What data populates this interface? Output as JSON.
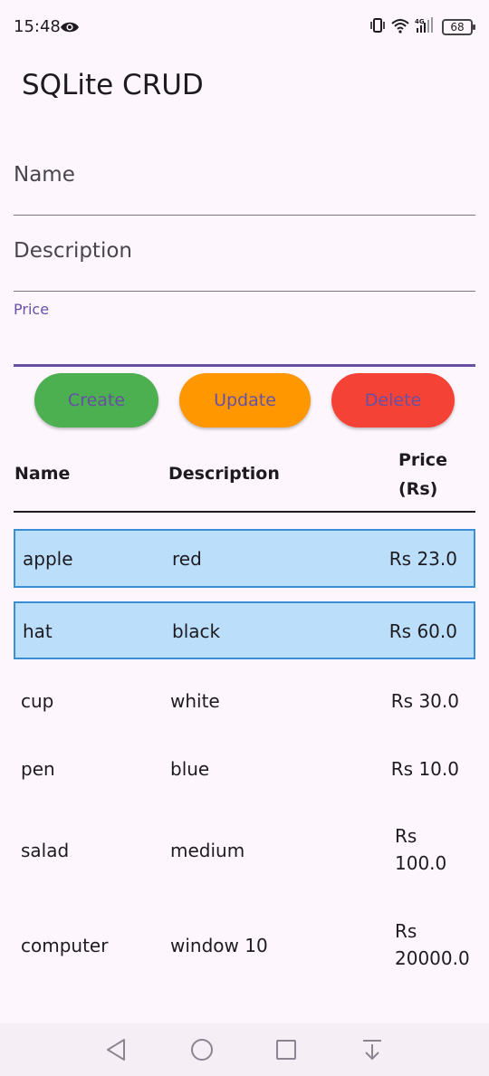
{
  "status_bar": {
    "time": "15:48",
    "battery": "68",
    "network": "4G"
  },
  "app_bar": {
    "title": "SQLite CRUD"
  },
  "form": {
    "name": {
      "label": "Name",
      "value": ""
    },
    "description": {
      "label": "Description",
      "value": ""
    },
    "price": {
      "label": "Price",
      "value": ""
    }
  },
  "buttons": {
    "create": "Create",
    "update": "Update",
    "delete": "Delete"
  },
  "table": {
    "headers": {
      "name": "Name",
      "description": "Description",
      "price_line1": "Price",
      "price_line2": "(Rs)"
    },
    "rows": [
      {
        "name": "apple",
        "description": "red",
        "price": "Rs 23.0",
        "selected": true
      },
      {
        "name": "hat",
        "description": "black",
        "price": "Rs 60.0",
        "selected": true
      },
      {
        "name": "cup",
        "description": "white",
        "price": "Rs 30.0",
        "selected": false
      },
      {
        "name": "pen",
        "description": "blue",
        "price": "Rs 10.0",
        "selected": false
      },
      {
        "name": "salad",
        "description": "medium",
        "price_line1": "Rs",
        "price_line2": "100.0",
        "selected": false
      },
      {
        "name": "computer",
        "description": "window 10",
        "price_line1": "Rs",
        "price_line2": "20000.0",
        "selected": false
      }
    ]
  },
  "colors": {
    "create": "#4caf50",
    "update": "#ff9800",
    "delete": "#f44336",
    "selected_row": "#bbdefb",
    "accent": "#6750a4"
  },
  "nav_bar": {
    "back": "back-triangle-icon",
    "home": "home-circle-icon",
    "recents": "recents-square-icon",
    "down": "down-arrow-icon"
  }
}
